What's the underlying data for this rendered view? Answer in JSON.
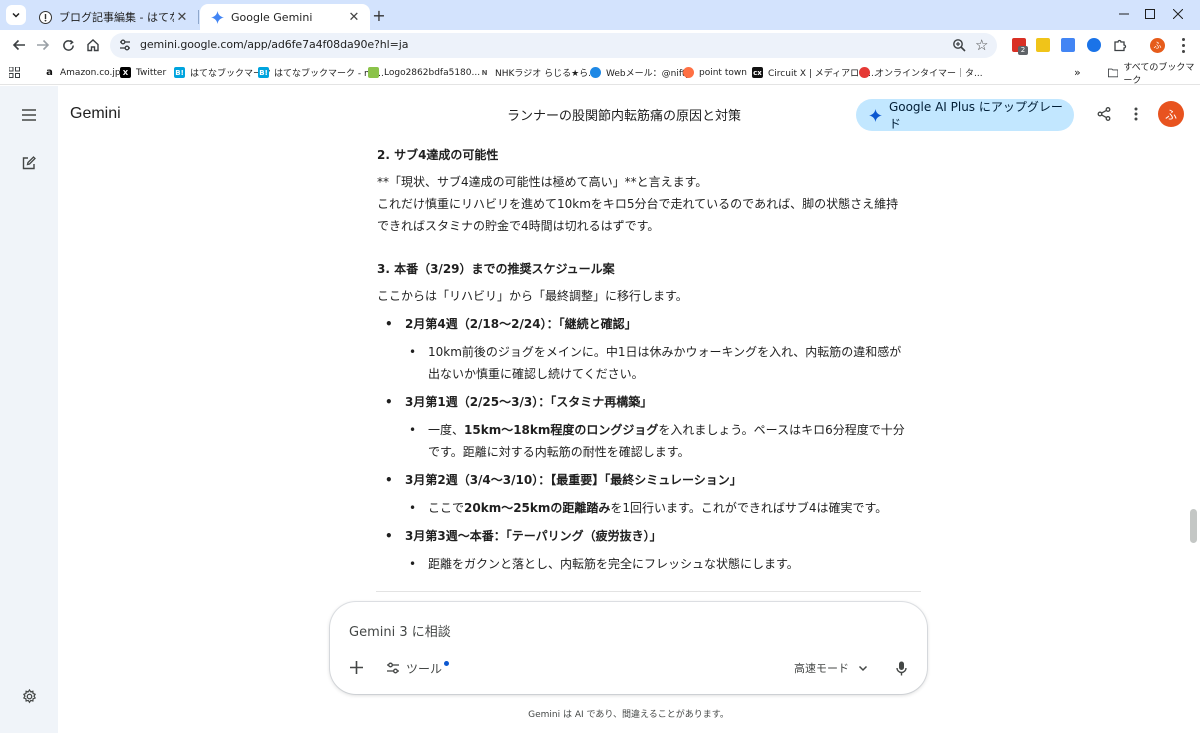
{
  "browser": {
    "tabs": [
      {
        "title": "ブログ記事編集 - はてなブログ",
        "icon": "hatena-blog-icon",
        "active": false
      },
      {
        "title": "Google Gemini",
        "icon": "gemini-spark-icon",
        "active": true
      }
    ],
    "url": "gemini.google.com/app/ad6fe7a4f08da90e?hl=ja",
    "bookmarks": [
      "Amazon.co.jp",
      "Twitter",
      "はてなブックマーク",
      "はてなブックマーク - mf...",
      "Logo2862bdfa5180...",
      "NHKラジオ らじる★ら...",
      "Webメール：@nifty",
      "point town",
      "Circuit X | メディアログ...",
      "オンラインタイマー｜タ..."
    ],
    "all_bookmarks": "すべてのブックマーク",
    "extension_badge": "2",
    "profile_initial": "ふ"
  },
  "gemini": {
    "brand": "Gemini",
    "conversation_title": "ランナーの股関節内転筋痛の原因と対策",
    "upgrade_label": "Google AI Plus にアップグレード",
    "avatar_initial": "ふ",
    "accent_color": "#c2e7ff",
    "answer": {
      "sec2_heading": "2. サブ4達成の可能性",
      "sec2_line1": "**「現状、サブ4達成の可能性は極めて高い」**と言えます。",
      "sec2_line2": "これだけ慎重にリハビリを進めて10kmをキロ5分台で走れているのであれば、脚の状態さえ維持",
      "sec2_line3": "できればスタミナの貯金で4時間は切れるはずです。",
      "sec3_heading": "3. 本番（3/29）までの推奨スケジュール案",
      "sec3_intro": "ここからは「リハビリ」から「最終調整」に移行します。",
      "w1_title": "2月第4週（2/18〜2/24）：「継続と確認」",
      "w1_detail_1": "10km前後のジョグをメインに。中1日は休みかウォーキングを入れ、内転筋の違和感が",
      "w1_detail_2": "出ないか慎重に確認し続けてください。",
      "w2_title": "3月第1週（2/25〜3/3）：「スタミナ再構築」",
      "w2_detail_pre": "一度、",
      "w2_detail_bold": "15km〜18km程度のロングジョグ",
      "w2_detail_post": "を入れましょう。ペースはキロ6分程度で十分",
      "w2_detail_2": "です。距離に対する内転筋の耐性を確認します。",
      "w3_title": "3月第2週（3/4〜3/10）：【最重要】「最終シミュレーション」",
      "w3_detail_pre": "ここで",
      "w3_detail_bold": "20km〜25kmの距離踏み",
      "w3_detail_post": "を1回行います。これができればサブ4は確実です。",
      "w4_title": "3月第3週〜本番：「テーパリング（疲労抜き）」",
      "w4_detail": "距離をガクンと落とし、内転筋を完全にフレッシュな状態にします。"
    },
    "input": {
      "placeholder": "Gemini 3 に相談",
      "tools_label": "ツール",
      "mode_label": "高速モード"
    },
    "disclaimer": "Gemini は AI であり、間違えることがあります。"
  }
}
